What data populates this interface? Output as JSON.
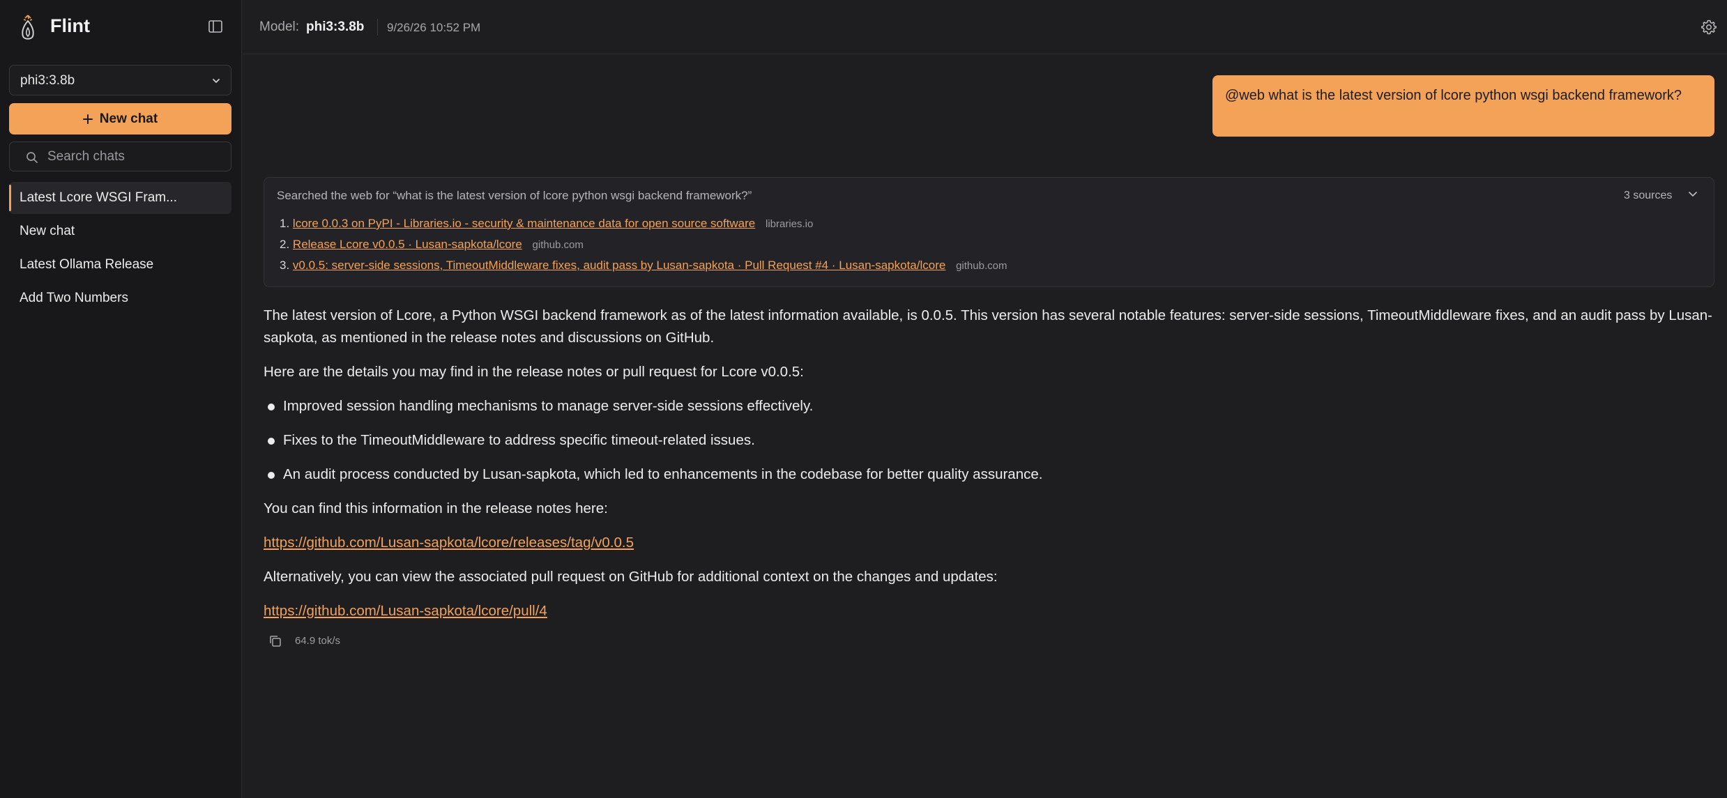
{
  "app": {
    "name": "Flint"
  },
  "sidebar": {
    "model_select": {
      "value": "phi3:3.8b"
    },
    "new_chat_label": "New chat",
    "search": {
      "placeholder": "Search chats"
    },
    "chats": [
      {
        "label": "Latest Lcore WSGI Fram...",
        "active": true
      },
      {
        "label": "New chat",
        "active": false
      },
      {
        "label": "Latest Ollama Release",
        "active": false
      },
      {
        "label": "Add Two Numbers",
        "active": false
      }
    ]
  },
  "header": {
    "model_label": "Model:",
    "model_name": "phi3:3.8b",
    "date": "9/26/26 10:52 PM"
  },
  "conversation": {
    "user_message": "@web what is the latest version of lcore python wsgi backend framework?",
    "sources": {
      "query_text": "Searched the web for “what is the latest version of lcore python wsgi backend framework?”",
      "count_label": "3 sources",
      "items": [
        {
          "num": "1.",
          "title": "lcore 0.0.3 on PyPI - Libraries.io - security & maintenance data for open source software",
          "domain": "libraries.io"
        },
        {
          "num": "2.",
          "title": "Release Lcore v0.0.5 · Lusan-sapkota/lcore",
          "domain": "github.com"
        },
        {
          "num": "3.",
          "title": "v0.0.5: server-side sessions, TimeoutMiddleware fixes, audit pass by Lusan-sapkota · Pull Request #4 · Lusan-sapkota/lcore",
          "domain": "github.com"
        }
      ]
    },
    "answer": {
      "p1": "The latest version of Lcore, a Python WSGI backend framework as of the latest information available, is 0.0.5. This version has several notable features: server-side sessions, TimeoutMiddleware fixes, and an audit pass by Lusan-sapkota, as mentioned in the release notes and discussions on GitHub.",
      "p2": "Here are the details you may find in the release notes or pull request for Lcore v0.0.5:",
      "bullets": [
        "Improved session handling mechanisms to manage server-side sessions effectively.",
        "Fixes to the TimeoutMiddleware to address specific timeout-related issues.",
        "An audit process conducted by Lusan-sapkota, which led to enhancements in the codebase for better quality assurance."
      ],
      "p3": "You can find this information in the release notes here:",
      "link1": "https://github.com/Lusan-sapkota/lcore/releases/tag/v0.0.5",
      "p4": "Alternatively, you can view the associated pull request on GitHub for additional context on the changes and updates:",
      "link2": "https://github.com/Lusan-sapkota/lcore/pull/4"
    },
    "stats": {
      "tok_rate": "64.9 tok/s"
    }
  },
  "icons": {
    "logo": "flint-logo-icon",
    "sidebar_toggle": "sidebar-toggle-icon",
    "chevron": "chevron-down-icon",
    "plus": "plus-icon",
    "search": "search-icon",
    "settings": "gear-icon",
    "copy": "copy-icon"
  },
  "colors": {
    "accent": "#f3a257",
    "background": "#1e1e21",
    "sidebar": "#18181b"
  }
}
